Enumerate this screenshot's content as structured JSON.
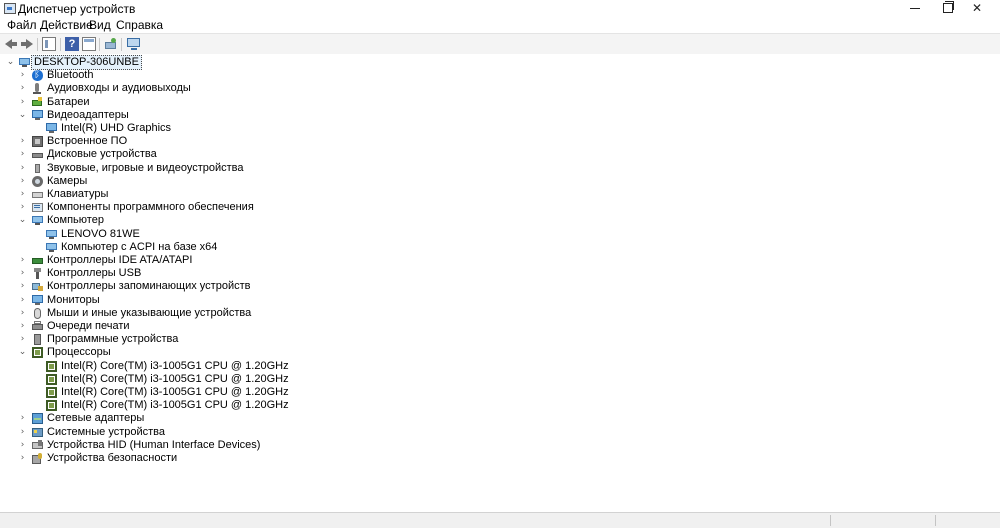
{
  "window": {
    "title": "Диспетчер устройств",
    "minimize": "minimize",
    "maximize": "maximize",
    "close": "✕"
  },
  "menu": {
    "file": "Файл",
    "action": "Действие",
    "view": "Вид",
    "help": "Справка"
  },
  "toolbar": {
    "back_icon": "arrow-left-icon",
    "forward_icon": "arrow-right-icon",
    "properties_icon": "properties-icon",
    "help_icon": "?",
    "panel_icon": "panel-icon",
    "scan_icon": "scan-hardware-icon",
    "monitor_icon": "monitor-icon"
  },
  "tree": {
    "root": "DESKTOP-306UNBE",
    "chevron_collapsed": "›",
    "chevron_expanded": "⌄",
    "items": [
      {
        "label": "Bluetooth",
        "icon": "bluetooth-icon",
        "expanded": false
      },
      {
        "label": "Аудиовходы и аудиовыходы",
        "icon": "audio-icon",
        "expanded": false
      },
      {
        "label": "Батареи",
        "icon": "battery-icon",
        "expanded": false
      },
      {
        "label": "Видеоадаптеры",
        "icon": "monitor-icon",
        "expanded": true,
        "children": [
          "Intel(R) UHD Graphics"
        ]
      },
      {
        "label": "Встроенное ПО",
        "icon": "firmware-icon",
        "expanded": false
      },
      {
        "label": "Дисковые устройства",
        "icon": "disk-icon",
        "expanded": false
      },
      {
        "label": "Звуковые, игровые и видеоустройства",
        "icon": "sound-icon",
        "expanded": false
      },
      {
        "label": "Камеры",
        "icon": "camera-icon",
        "expanded": false
      },
      {
        "label": "Клавиатуры",
        "icon": "keyboard-icon",
        "expanded": false
      },
      {
        "label": "Компоненты программного обеспечения",
        "icon": "software-icon",
        "expanded": false
      },
      {
        "label": "Компьютер",
        "icon": "computer-icon",
        "expanded": true,
        "children": [
          "LENOVO 81WE",
          "Компьютер с ACPI на базе x64"
        ]
      },
      {
        "label": "Контроллеры IDE ATA/ATAPI",
        "icon": "ide-controller-icon",
        "expanded": false
      },
      {
        "label": "Контроллеры USB",
        "icon": "usb-icon",
        "expanded": false
      },
      {
        "label": "Контроллеры запоминающих устройств",
        "icon": "storage-controller-icon",
        "expanded": false
      },
      {
        "label": "Мониторы",
        "icon": "monitor-icon",
        "expanded": false
      },
      {
        "label": "Мыши и иные указывающие устройства",
        "icon": "mouse-icon",
        "expanded": false
      },
      {
        "label": "Очереди печати",
        "icon": "printer-icon",
        "expanded": false
      },
      {
        "label": "Программные устройства",
        "icon": "software-device-icon",
        "expanded": false
      },
      {
        "label": "Процессоры",
        "icon": "processor-icon",
        "expanded": true,
        "children": [
          "Intel(R) Core(TM) i3-1005G1 CPU @ 1.20GHz",
          "Intel(R) Core(TM) i3-1005G1 CPU @ 1.20GHz",
          "Intel(R) Core(TM) i3-1005G1 CPU @ 1.20GHz",
          "Intel(R) Core(TM) i3-1005G1 CPU @ 1.20GHz"
        ]
      },
      {
        "label": "Сетевые адаптеры",
        "icon": "network-adapter-icon",
        "expanded": false
      },
      {
        "label": "Системные устройства",
        "icon": "system-device-icon",
        "expanded": false
      },
      {
        "label": "Устройства HID (Human Interface Devices)",
        "icon": "hid-icon",
        "expanded": false
      },
      {
        "label": "Устройства безопасности",
        "icon": "security-device-icon",
        "expanded": false
      }
    ]
  }
}
